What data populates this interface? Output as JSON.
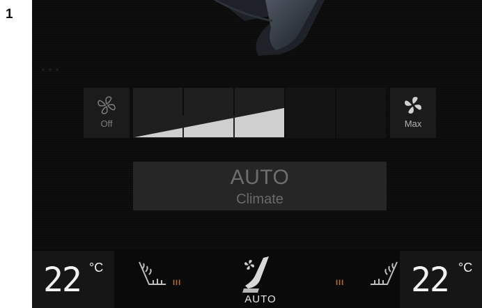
{
  "figure_number": "1",
  "fan": {
    "off_label": "Off",
    "max_label": "Max",
    "level": 3,
    "level_max": 5
  },
  "auto_button": {
    "title": "AUTO",
    "subtitle": "Climate"
  },
  "bottom": {
    "left_temp": "22",
    "right_temp": "22",
    "unit": "°C",
    "left_seat_heat_level": "III",
    "right_seat_heat_level": "III",
    "airflow_mode": "AUTO"
  },
  "icons": {
    "fan_off": "fan-outline-icon",
    "fan_max": "fan-solid-icon",
    "seat_heat": "heated-seat-icon",
    "airflow": "airflow-seat-icon"
  },
  "colors": {
    "heat_indicator": "#c9681a",
    "screen_bg": "#0c0c0c"
  }
}
